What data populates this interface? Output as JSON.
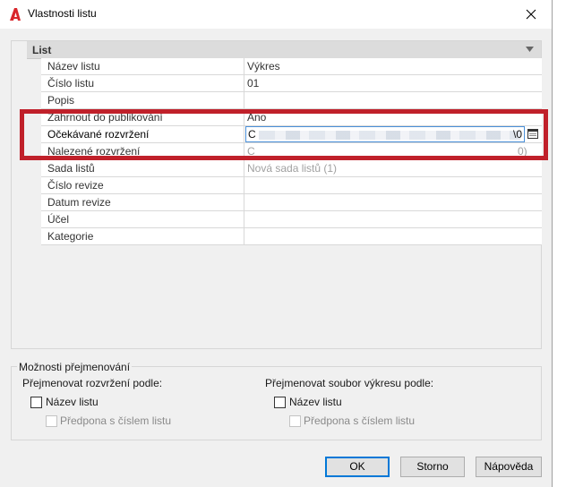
{
  "window": {
    "title": "Vlastnosti listu",
    "icon": "autocad-a-icon",
    "brand_color": "#d9262b"
  },
  "section": {
    "title": "List"
  },
  "properties": [
    {
      "name": "Název listu",
      "value": "Výkres"
    },
    {
      "name": "Číslo listu",
      "value": "01"
    },
    {
      "name": "Popis",
      "value": ""
    },
    {
      "name": "Zahrnout do publikování",
      "value": "Ano"
    },
    {
      "name": "Očekávané rozvržení",
      "value": "C",
      "value_end": "\\0"
    },
    {
      "name": "Nalezené rozvržení",
      "value": "C",
      "value_end": "0)"
    },
    {
      "name": "Sada listů",
      "value": "Nová sada listů (1)"
    },
    {
      "name": "Číslo revize",
      "value": ""
    },
    {
      "name": "Datum revize",
      "value": ""
    },
    {
      "name": "Účel",
      "value": ""
    },
    {
      "name": "Kategorie",
      "value": ""
    }
  ],
  "highlight_color": "#c0202a",
  "rename": {
    "group_label": "Možnosti přejmenování",
    "layout": {
      "heading": "Přejmenovat rozvržení podle:",
      "checkbox_label": "Název listu",
      "checkbox_checked": false,
      "sub_label": "Předpona s číslem listu",
      "sub_checked": false
    },
    "drawing": {
      "heading": "Přejmenovat soubor výkresu podle:",
      "checkbox_label": "Název listu",
      "checkbox_checked": false,
      "sub_label": "Předpona s číslem listu",
      "sub_checked": false
    }
  },
  "buttons": {
    "ok": "OK",
    "cancel": "Storno",
    "help": "Nápověda"
  }
}
